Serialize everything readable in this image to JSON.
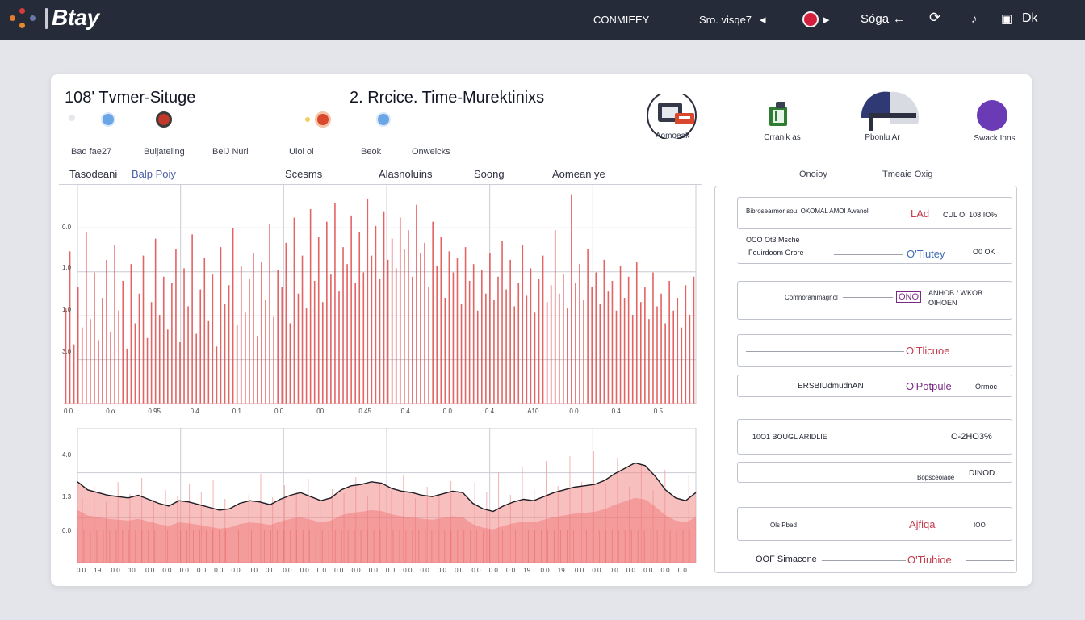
{
  "topbar": {
    "brand": "Btay",
    "items": [
      "CONMIEEY",
      "Sro. visqe7",
      "Sóga",
      "Dk"
    ],
    "icons": [
      "logo-dots",
      "play",
      "record",
      "play-small",
      "arrow-left",
      "refresh",
      "user",
      "window"
    ],
    "colors": {
      "bg": "#262b3a",
      "record": "#d31f3c"
    }
  },
  "left_panel": {
    "title": "108' Tvmer-Situge",
    "columns": [
      "Bad fae27",
      "Buijateiing",
      "BeiJ Nurl",
      "Uiol ol",
      "Beok",
      "Onweicks"
    ],
    "tabs": [
      "Tasodeani",
      "Balp Poiy",
      "Scesms",
      "Alasnoluins",
      "Soong",
      "Aomean ye"
    ]
  },
  "center_panel": {
    "title": "2. Rrcice. Time-Murektinixs"
  },
  "top_icons": [
    {
      "label": "Aomoeak",
      "icon": "monitor-chart-icon"
    },
    {
      "label": "Crranik as",
      "icon": "book-icon"
    },
    {
      "label": "Pbonlu Ar",
      "icon": "half-circle-icon"
    },
    {
      "label": "Swack Inns",
      "icon": "purple-dot-icon"
    }
  ],
  "right_panel": {
    "headers": [
      "Onoioy",
      "Tmeaie Oxig"
    ],
    "rows": [
      {
        "text": "Bibrosearmor sou. OKOMAL AMOI Awanol",
        "value": "LAd",
        "meta": "CUL OI 108 IO%"
      },
      {
        "text": "OCO Ot3 Msche",
        "sub": "Fouirdoom Orore",
        "value": "O'Tiutey",
        "meta": "O0 OK"
      },
      {
        "text": "Comnorammagnol",
        "value": "ONO",
        "meta": "ANHOB / WKOB OIHOEN"
      },
      {
        "text": "",
        "value": "O'Tlicuoe",
        "meta": ""
      },
      {
        "text": "ERSBIUdmudnAN",
        "value": "O'Potpule",
        "meta": "Ormoc"
      },
      {
        "text": "10O1 BOUGL ARIDLIE",
        "value": "O-2HO3%",
        "meta": ""
      },
      {
        "text": "Bopsceoiaoe",
        "value": "DINOD",
        "meta": ""
      },
      {
        "text": "Ols Pbed",
        "value": "Ajfiqa",
        "meta": "IOO"
      },
      {
        "text": "OOF Simacone",
        "value": "O'Tiuhioe",
        "meta": ""
      }
    ]
  },
  "chart_data": [
    {
      "type": "bar",
      "title": "",
      "color": "#e04848",
      "yticks": [
        "0.0",
        "1.0",
        "1.0",
        "3.0"
      ],
      "xticks": [
        "0.0",
        "0.o",
        "0.95",
        "0.4",
        "0.1",
        "0.0",
        "00",
        "0.45",
        "0.4",
        "0.0",
        "0.4",
        "A10",
        "0.0",
        "0.4",
        "0.5"
      ],
      "ylim": [
        0,
        100
      ],
      "values": [
        45,
        72,
        28,
        55,
        36,
        81,
        40,
        62,
        30,
        50,
        68,
        34,
        75,
        44,
        58,
        26,
        66,
        38,
        52,
        70,
        31,
        48,
        78,
        42,
        60,
        35,
        57,
        73,
        29,
        64,
        46,
        80,
        33,
        54,
        69,
        39,
        61,
        27,
        74,
        47,
        56,
        83,
        37,
        65,
        43,
        59,
        71,
        32,
        67,
        49,
        85,
        41,
        63,
        55,
        76,
        38,
        88,
        52,
        70,
        45,
        92,
        58,
        79,
        48,
        86,
        61,
        95,
        53,
        74,
        66,
        89,
        57,
        81,
        62,
        97,
        70,
        84,
        59,
        91,
        68,
        78,
        64,
        88,
        73,
        82,
        60,
        94,
        71,
        76,
        55,
        86,
        65,
        79,
        50,
        72,
        62,
        69,
        47,
        74,
        58,
        66,
        44,
        63,
        52,
        71,
        49,
        60,
        77,
        54,
        68,
        46,
        57,
        75,
        51,
        64,
        43,
        59,
        70,
        48,
        56,
        82,
        52,
        61,
        45,
        99,
        57,
        66,
        49,
        73,
        55,
        62,
        47,
        68,
        53,
        58,
        44,
        65,
        50,
        60,
        42,
        67,
        48,
        55,
        40,
        62,
        46,
        52,
        38,
        58,
        44,
        50,
        36,
        56,
        42,
        60
      ]
    },
    {
      "type": "area",
      "title": "",
      "color": "#e04848",
      "yticks": [
        "4.0",
        "1.3",
        "0.0"
      ],
      "xticks": [
        "0.0",
        "19",
        "0.0",
        "10",
        "0.0",
        "0.0",
        "0.0",
        "0.0",
        "0.0",
        "0.0",
        "0.0",
        "0.0",
        "0.0",
        "0.0",
        "0.0",
        "0.0",
        "0.0",
        "0.0",
        "0.0",
        "0.0",
        "0.0",
        "0.0",
        "0.0",
        "0.0",
        "0.0",
        "0.0",
        "19",
        "0.0",
        "19",
        "0.0",
        "0.0",
        "0.0",
        "0.0",
        "0.0",
        "0.0",
        "0.0"
      ],
      "ylim": [
        0,
        100
      ],
      "values": [
        60,
        54,
        52,
        50,
        49,
        48,
        50,
        47,
        44,
        42,
        46,
        45,
        43,
        41,
        39,
        40,
        44,
        46,
        45,
        43,
        47,
        50,
        52,
        49,
        46,
        48,
        54,
        57,
        58,
        60,
        59,
        55,
        53,
        52,
        50,
        49,
        51,
        53,
        52,
        44,
        40,
        38,
        42,
        45,
        47,
        46,
        49,
        52,
        54,
        56,
        57,
        58,
        61,
        66,
        70,
        74,
        72,
        64,
        54,
        48,
        46,
        52
      ],
      "spikes": [
        20,
        35,
        15,
        40,
        25,
        45,
        18,
        30,
        22,
        38,
        27,
        42,
        19,
        33,
        24,
        50,
        21,
        36,
        28,
        44,
        17,
        31,
        26,
        46,
        23,
        37,
        29,
        48,
        20,
        34,
        25,
        41,
        22,
        39,
        27,
        52,
        24,
        58,
        30,
        66,
        35,
        72,
        40,
        78,
        38,
        70,
        34,
        62,
        30,
        55,
        26,
        48
      ]
    }
  ]
}
